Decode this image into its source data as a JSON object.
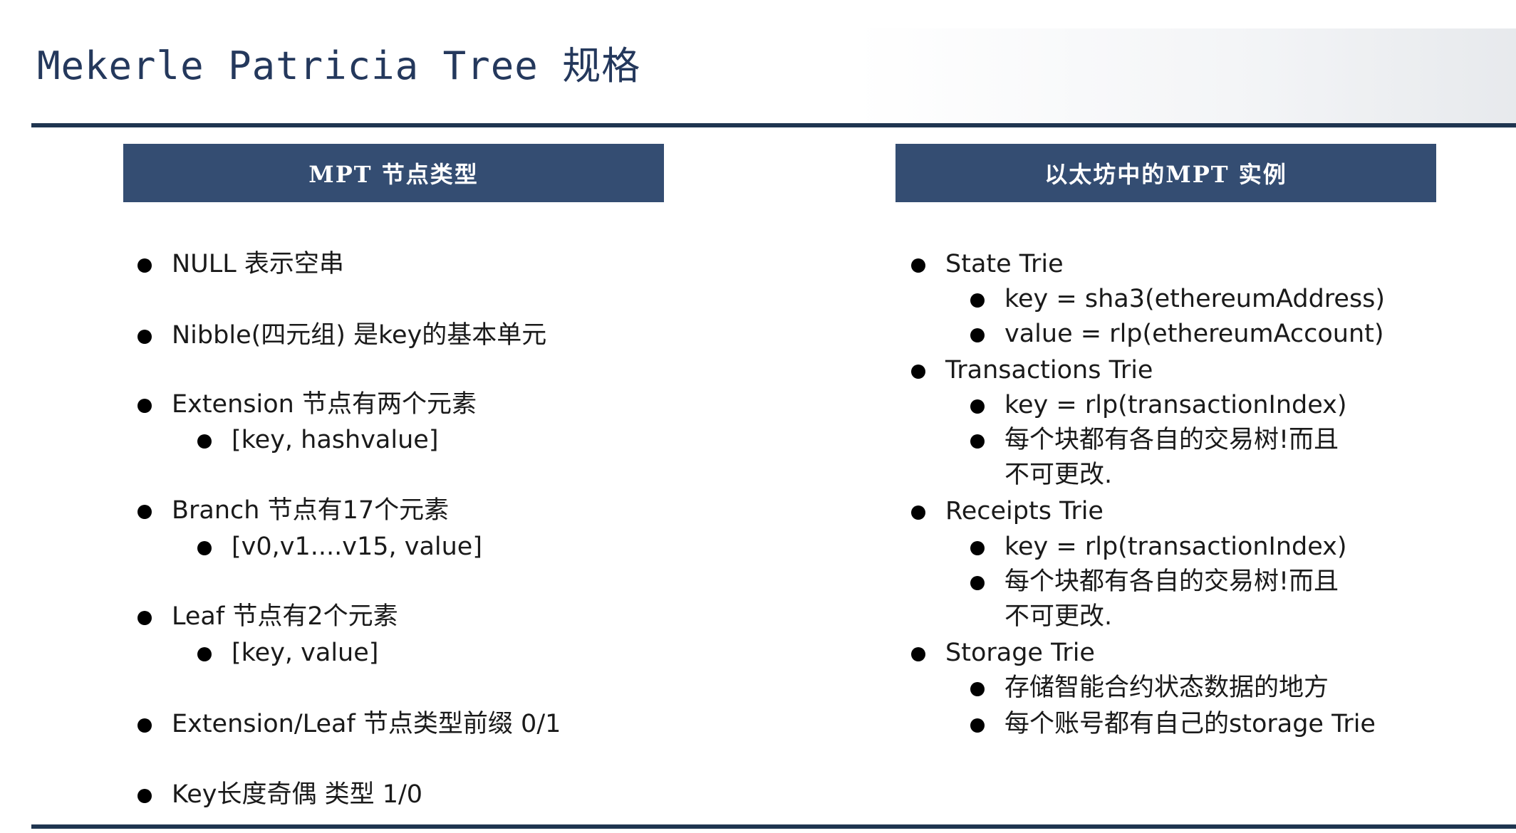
{
  "slide": {
    "title": "Mekerle Patricia Tree 规格"
  },
  "left": {
    "header": "MPT 节点类型",
    "items": [
      "NULL 表示空串",
      "Nibble(四元组) 是key的基本单元",
      "Extension 节点有两个元素",
      "[key, hashvalue]",
      "Branch 节点有17个元素",
      "[v0,v1....v15, value]",
      "Leaf 节点有2个元素",
      "[key, value]",
      "Extension/Leaf 节点类型前缀 0/1",
      "Key长度奇偶 类型 1/0"
    ]
  },
  "right": {
    "header": "以太坊中的MPT 实例",
    "items": [
      "State Trie",
      "key = sha3(ethereumAddress)",
      "value = rlp(ethereumAccount)",
      "Transactions Trie",
      "key = rlp(transactionIndex)",
      "每个块都有各自的交易树!而且",
      "不可更改.",
      "Receipts Trie",
      "key = rlp(transactionIndex)",
      "每个块都有各自的交易树!而且",
      "不可更改.",
      "Storage Trie",
      "存储智能合约状态数据的地方",
      "每个账号都有自己的storage Trie"
    ]
  }
}
